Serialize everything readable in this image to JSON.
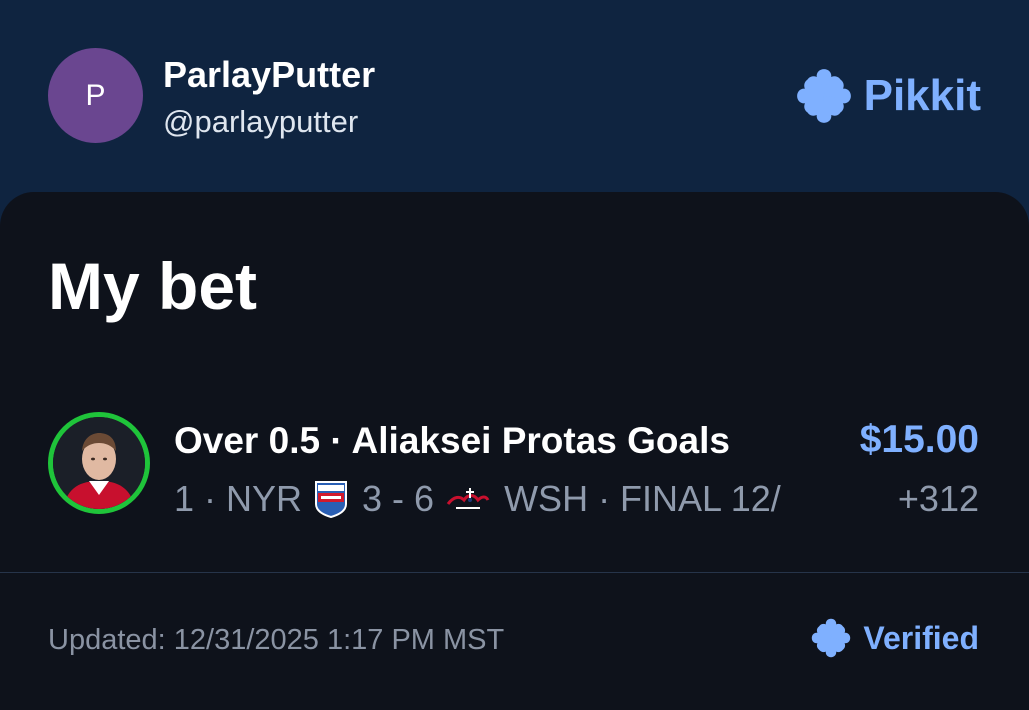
{
  "header": {
    "avatar_initial": "P",
    "user_name": "ParlayPutter",
    "user_handle": "@parlayputter",
    "brand_name": "Pikkit"
  },
  "card": {
    "title": "My bet",
    "bet": {
      "title": "Over 0.5 · Aliaksei Protas Goals",
      "sub_left": "1 · NYR",
      "score": "3 - 6",
      "sub_right": "WSH · FINAL 12/",
      "amount": "$15.00",
      "odds": "+312"
    },
    "footer": {
      "updated": "Updated: 12/31/2025 1:17 PM MST",
      "verified": "Verified"
    }
  },
  "colors": {
    "header_bg": "#0f2440",
    "card_bg": "#0e121b",
    "accent": "#7fb0ff",
    "ring": "#1fc43a",
    "avatar": "#6a4690",
    "muted": "#8f9aac"
  },
  "icons": {
    "brand": "clover-icon",
    "verified": "clover-icon",
    "team_home": "rangers-logo-icon",
    "team_away": "capitals-logo-icon",
    "player": "player-headshot"
  }
}
